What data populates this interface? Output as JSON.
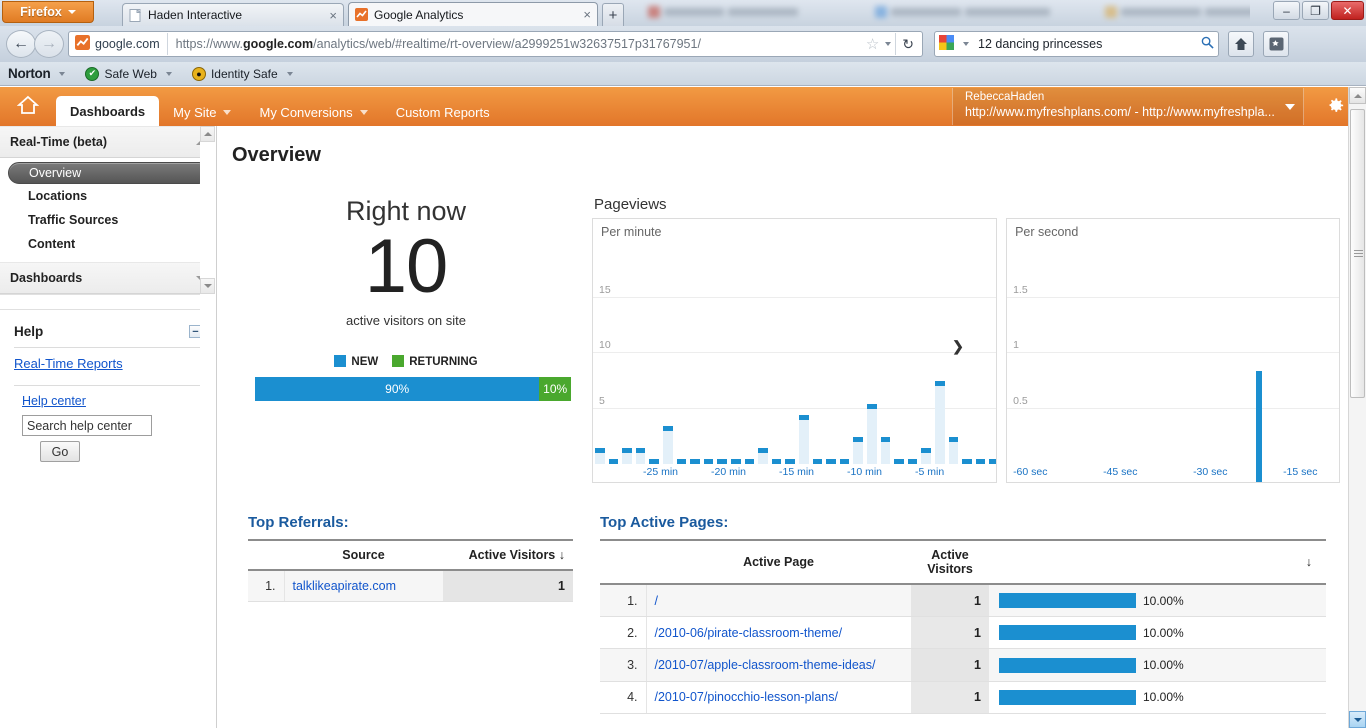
{
  "browser": {
    "firefox_button": "Firefox",
    "tabs": [
      {
        "title": "Haden Interactive",
        "favicon": "page-icon",
        "active": false,
        "close": "×"
      },
      {
        "title": "Google Analytics",
        "favicon": "analytics-icon",
        "active": true,
        "close": "×"
      }
    ],
    "new_tab_label": "+",
    "window_buttons": {
      "minimize": "–",
      "maximize": "❐",
      "close": "✕"
    },
    "nav": {
      "back": "←",
      "forward": "→",
      "identity_label": "google.com",
      "url_prefix": "https://www.",
      "url_domain": "google.com",
      "url_suffix": "/analytics/web/#realtime/rt-overview/a2999251w32637517p31767951/",
      "bookmark_star": "☆",
      "reload": "↻",
      "search_value": "12 dancing princesses",
      "search_magnifier": "⚲",
      "home": "⌂",
      "bookmarks_sidebar": "❐"
    },
    "bookmarks": [
      {
        "label": "Norton",
        "icon": "norton-logo"
      },
      {
        "label": "Safe Web",
        "icon": "safeweb-icon"
      },
      {
        "label": "Identity Safe",
        "icon": "identitysafe-icon"
      }
    ]
  },
  "ga": {
    "home_icon": "home-icon",
    "nav_tabs": [
      {
        "label": "Dashboards",
        "selected": true,
        "caret": false
      },
      {
        "label": "My Site",
        "selected": false,
        "caret": true
      },
      {
        "label": "My Conversions",
        "selected": false,
        "caret": true
      },
      {
        "label": "Custom Reports",
        "selected": false,
        "caret": false
      }
    ],
    "account": {
      "user": "RebeccaHaden",
      "property": "http://www.myfreshplans.com/ - http://www.myfreshpla..."
    },
    "settings_icon": "gear-icon"
  },
  "sidebar": {
    "sections": [
      {
        "title": "Real-Time (beta)",
        "state": "expanded",
        "items": [
          {
            "label": "Overview",
            "selected": true
          },
          {
            "label": "Locations",
            "selected": false
          },
          {
            "label": "Traffic Sources",
            "selected": false
          },
          {
            "label": "Content",
            "selected": false
          }
        ]
      },
      {
        "title": "Dashboards",
        "state": "collapsed",
        "items": []
      }
    ],
    "help": {
      "title": "Help",
      "collapse_icon": "minus-icon",
      "primary_link": "Real-Time Reports",
      "center_link": "Help center",
      "search_value": "Search help center",
      "go_label": "Go"
    }
  },
  "main": {
    "page_title": "Overview",
    "right_now": {
      "label": "Right now",
      "value": "10",
      "sub": "active visitors on site",
      "legend": [
        {
          "label": "NEW",
          "color": "#1b8fd0"
        },
        {
          "label": "RETURNING",
          "color": "#4aa82e"
        }
      ],
      "bar": [
        {
          "label": "90%",
          "pct": 90,
          "color": "#1b8fd0"
        },
        {
          "label": "10%",
          "pct": 10,
          "color": "#4aa82e"
        }
      ]
    },
    "pageviews": {
      "title": "Pageviews",
      "expand_icon": "❯"
    },
    "referrals": {
      "title": "Top Referrals:",
      "columns": [
        "",
        "Source",
        "Active Visitors"
      ],
      "sort_icon": "↓",
      "rows": [
        {
          "rank": "1.",
          "source": "talklikeapirate.com",
          "visitors": "1"
        }
      ]
    },
    "active_pages": {
      "title": "Top Active Pages:",
      "columns": [
        "",
        "Active Page",
        "Active Visitors",
        ""
      ],
      "sort_icon": "↓",
      "rows": [
        {
          "rank": "1.",
          "page": "/",
          "visitors": "1",
          "pct": "10.00%",
          "pct_value": 10
        },
        {
          "rank": "2.",
          "page": "/2010-06/pirate-classroom-theme/",
          "visitors": "1",
          "pct": "10.00%",
          "pct_value": 10
        },
        {
          "rank": "3.",
          "page": "/2010-07/apple-classroom-theme-ideas/",
          "visitors": "1",
          "pct": "10.00%",
          "pct_value": 10
        },
        {
          "rank": "4.",
          "page": "/2010-07/pinocchio-lesson-plans/",
          "visitors": "1",
          "pct": "10.00%",
          "pct_value": 10
        }
      ]
    }
  },
  "chart_data": [
    {
      "type": "bar",
      "title": "Pageviews",
      "subtitle": "Per minute",
      "xlabel": "",
      "ylabel": "",
      "ylim": [
        0,
        20
      ],
      "yticks": [
        5,
        10,
        15
      ],
      "xticks": [
        "-25 min",
        "-20 min",
        "-15 min",
        "-10 min",
        "-5 min"
      ],
      "grid": true,
      "bar_color": "#1b8fd0",
      "bar_fill": "#e3f0f9",
      "categories": [
        "-30",
        "-29",
        "-28",
        "-27",
        "-26",
        "-25",
        "-24",
        "-23",
        "-22",
        "-21",
        "-20",
        "-19",
        "-18",
        "-17",
        "-16",
        "-15",
        "-14",
        "-13",
        "-12",
        "-11",
        "-10",
        "-9",
        "-8",
        "-7",
        "-6",
        "-5",
        "-4",
        "-3",
        "-2",
        "-1"
      ],
      "values": [
        1,
        0,
        1,
        1,
        0,
        3,
        0,
        0,
        0,
        0,
        0,
        0,
        1,
        0,
        0,
        4,
        0,
        0,
        0,
        2,
        5,
        2,
        0,
        0,
        1,
        7,
        2,
        0,
        0,
        0
      ]
    },
    {
      "type": "bar",
      "title": "Pageviews",
      "subtitle": "Per second",
      "xlabel": "",
      "ylabel": "",
      "ylim": [
        0,
        2
      ],
      "yticks": [
        0.5,
        1,
        1.5
      ],
      "xticks": [
        "-60 sec",
        "-45 sec",
        "-30 sec",
        "-15 sec"
      ],
      "grid": true,
      "bar_color": "#1b8fd0",
      "categories": [
        "-15"
      ],
      "values": [
        1
      ]
    },
    {
      "type": "bar",
      "title": "New vs Returning",
      "categories": [
        "NEW",
        "RETURNING"
      ],
      "values": [
        90,
        10
      ],
      "ylim": [
        0,
        100
      ],
      "ylabel": "%"
    }
  ]
}
